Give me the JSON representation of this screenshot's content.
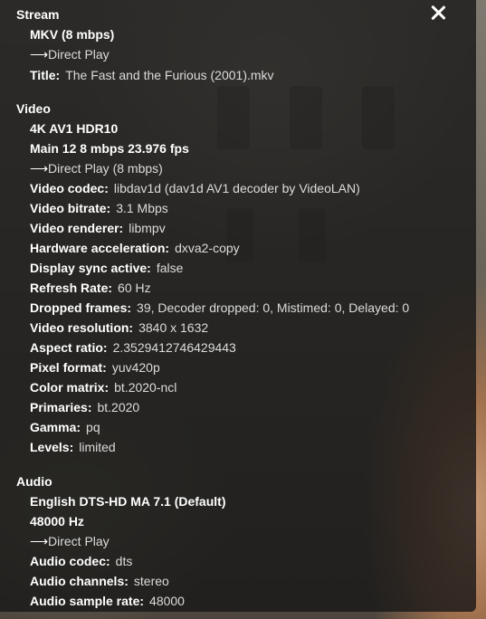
{
  "close_icon": "close-x-icon",
  "stream": {
    "heading": "Stream",
    "container": "MKV (8 mbps)",
    "play_method": "Direct Play",
    "title_label": "Title:",
    "title_value": "The Fast and the Furious (2001).mkv"
  },
  "video": {
    "heading": "Video",
    "line1": "4K AV1 HDR10",
    "line2": "Main 12 8 mbps 23.976 fps",
    "play_method": "Direct Play (8 mbps)",
    "rows": [
      {
        "label": "Video codec:",
        "value": "libdav1d (dav1d AV1 decoder by VideoLAN)"
      },
      {
        "label": "Video bitrate:",
        "value": "3.1 Mbps"
      },
      {
        "label": "Video renderer:",
        "value": "libmpv"
      },
      {
        "label": "Hardware acceleration:",
        "value": "dxva2-copy"
      },
      {
        "label": "Display sync active:",
        "value": "false"
      },
      {
        "label": "Refresh Rate:",
        "value": "60 Hz"
      },
      {
        "label": "Dropped frames:",
        "value": "39, Decoder dropped: 0, Mistimed: 0, Delayed: 0"
      },
      {
        "label": "Video resolution:",
        "value": "3840 x 1632"
      },
      {
        "label": "Aspect ratio:",
        "value": "2.3529412746429443"
      },
      {
        "label": "Pixel format:",
        "value": "yuv420p"
      },
      {
        "label": "Color matrix:",
        "value": "bt.2020-ncl"
      },
      {
        "label": "Primaries:",
        "value": "bt.2020"
      },
      {
        "label": "Gamma:",
        "value": "pq"
      },
      {
        "label": "Levels:",
        "value": "limited"
      }
    ]
  },
  "audio": {
    "heading": "Audio",
    "line1": "English DTS-HD MA 7.1 (Default)",
    "line2": "48000 Hz",
    "play_method": "Direct Play",
    "rows": [
      {
        "label": "Audio codec:",
        "value": "dts"
      },
      {
        "label": "Audio channels:",
        "value": "stereo"
      },
      {
        "label": "Audio sample rate:",
        "value": "48000"
      }
    ]
  }
}
